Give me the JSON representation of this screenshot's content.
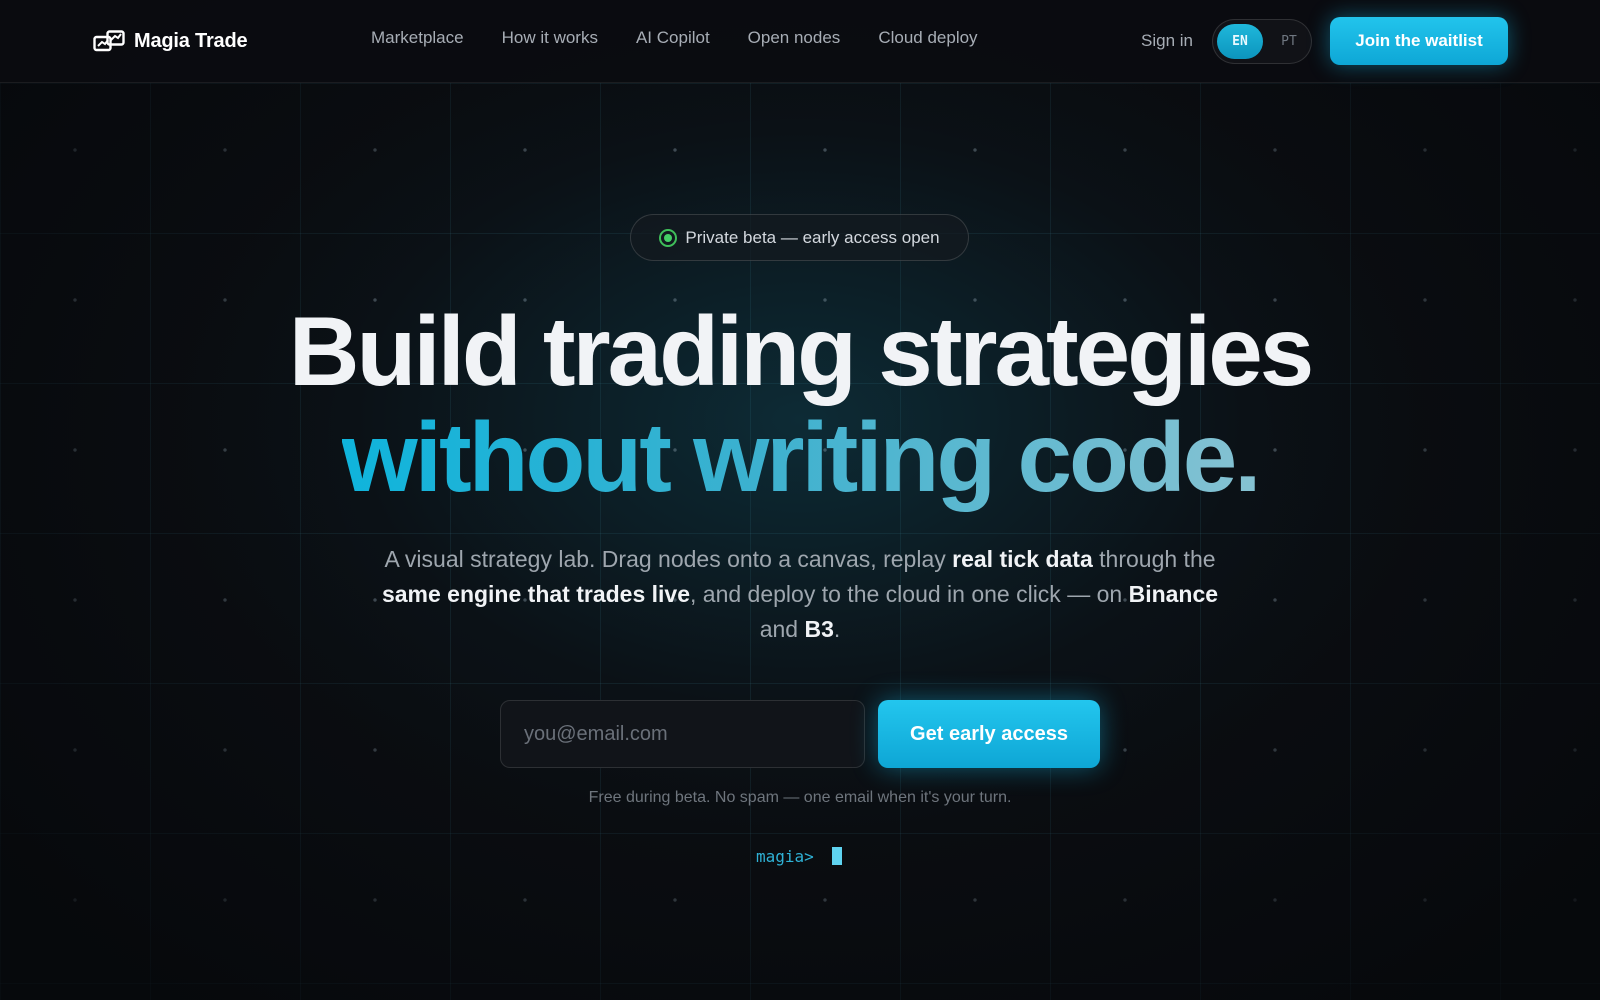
{
  "brand": {
    "name": "Magia Trade",
    "icon": "linked-charts-logo-icon"
  },
  "nav": {
    "links": [
      "Marketplace",
      "How it works",
      "AI Copilot",
      "Open nodes",
      "Cloud deploy"
    ],
    "sign_in": "Sign in",
    "languages": {
      "active": "EN",
      "inactive": "PT"
    },
    "waitlist_button": "Join the waitlist"
  },
  "badge": {
    "text": "Private beta — early access open",
    "status_color": "#44d066"
  },
  "hero": {
    "headline_line1": "Build trading strategies",
    "headline_line2": "without writing code.",
    "subtitle": {
      "p1": "A visual strategy lab. Drag nodes onto a canvas, replay ",
      "b1": "real tick data",
      "p2": " through the ",
      "b2": "same engine that trades live",
      "p3": ", and deploy to the cloud in one click — on ",
      "b3": "Binance",
      "p4": " and ",
      "b4": "B3",
      "p5": "."
    }
  },
  "signup": {
    "email_placeholder": "you@email.com",
    "email_value": "",
    "cta": "Get early access",
    "note": "Free during beta. No spam — one email when it's your turn."
  },
  "terminal": {
    "prompt": "magia>"
  },
  "colors": {
    "accent": "#12b5e0",
    "background": "#0b0e12"
  }
}
